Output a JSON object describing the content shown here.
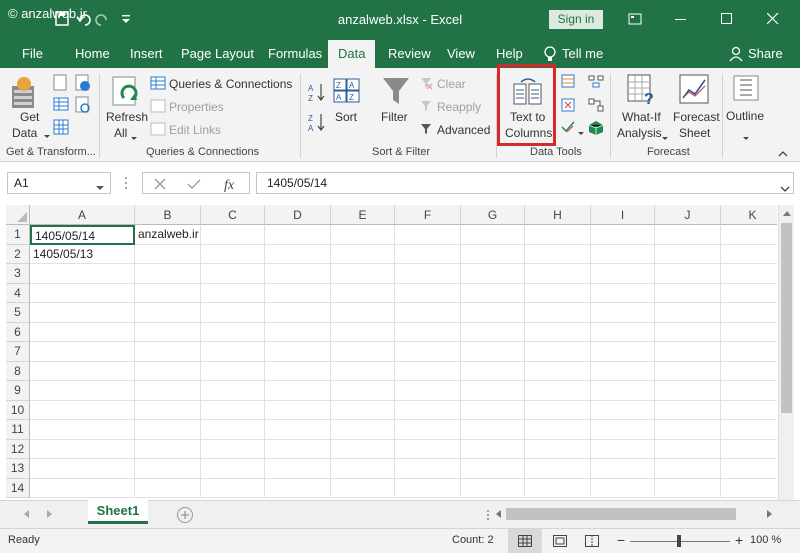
{
  "titlebar": {
    "watermark": "© anzalweb.ir",
    "title": "anzalweb.xlsx  -  Excel",
    "sign_in": "Sign in",
    "qat_icons": [
      "save-icon",
      "undo-icon",
      "redo-icon",
      "customize-icon"
    ],
    "window_icons": [
      "ribbon-display-icon",
      "minimize-icon",
      "maximize-icon",
      "close-icon"
    ]
  },
  "tabs": [
    {
      "label": "File"
    },
    {
      "label": "Home"
    },
    {
      "label": "Insert"
    },
    {
      "label": "Page Layout"
    },
    {
      "label": "Formulas"
    },
    {
      "label": "Data"
    },
    {
      "label": "Review"
    },
    {
      "label": "View"
    },
    {
      "label": "Help"
    },
    {
      "label": "Tell me"
    }
  ],
  "share_label": "Share",
  "ribbon": {
    "get_data_1": "Get",
    "get_data_2": "Data",
    "refresh_1": "Refresh",
    "refresh_2": "All",
    "queries_connections": "Queries & Connections",
    "properties": "Properties",
    "edit_links": "Edit Links",
    "sort": "Sort",
    "filter": "Filter",
    "clear": "Clear",
    "reapply": "Reapply",
    "advanced": "Advanced",
    "text_to_1": "Text to",
    "text_to_2": "Columns",
    "whatif_1": "What-If",
    "whatif_2": "Analysis",
    "forecast_1": "Forecast",
    "forecast_2": "Sheet",
    "outline": "Outline",
    "groups": {
      "get_transform": "Get & Transform...",
      "queries": "Queries & Connections",
      "sort_filter": "Sort & Filter",
      "data_tools": "Data Tools",
      "forecast": "Forecast"
    }
  },
  "formula_bar": {
    "name_box": "A1",
    "value": "1405/05/14"
  },
  "grid": {
    "columns": [
      "A",
      "B",
      "C",
      "D",
      "E",
      "F",
      "G",
      "H",
      "I",
      "J",
      "K"
    ],
    "rows": [
      "1",
      "2",
      "3",
      "4",
      "5",
      "6",
      "7",
      "8",
      "9",
      "10",
      "11",
      "12",
      "13",
      "14"
    ],
    "cells": {
      "A1": "1405/05/14",
      "B1": "anzalweb.ir",
      "A2": "1405/05/13"
    }
  },
  "sheets": [
    {
      "label": "Sheet1"
    }
  ],
  "status": {
    "ready": "Ready",
    "count": "Count: 2",
    "zoom": "100 %"
  }
}
